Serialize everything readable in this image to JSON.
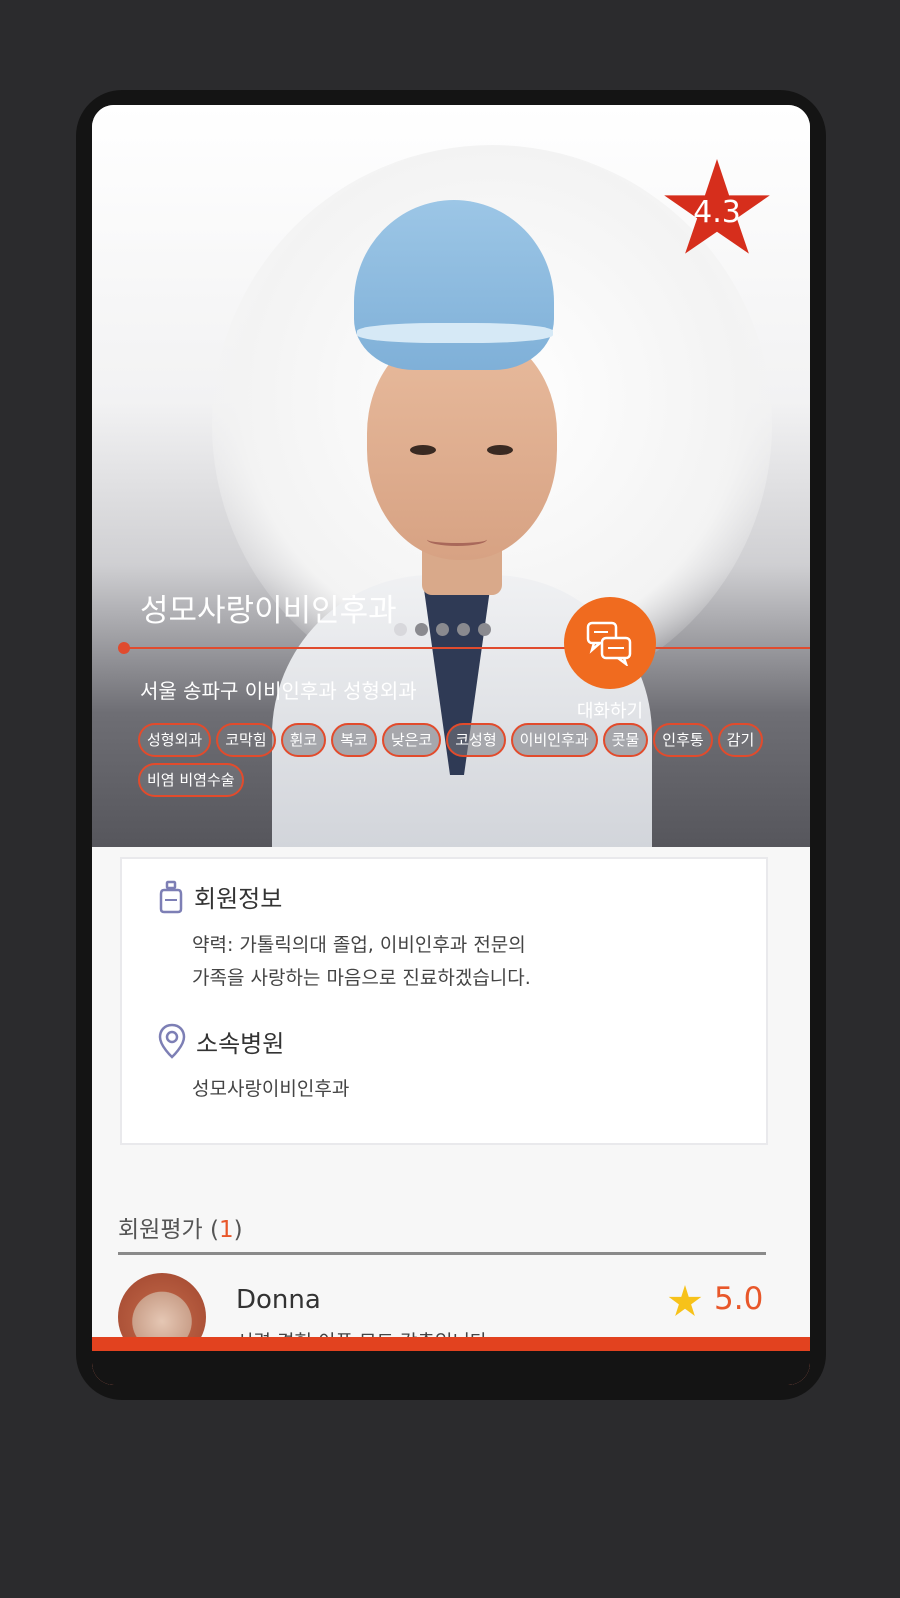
{
  "hero": {
    "rating": "4.3",
    "hospital_name": "성모사랑이비인후과",
    "address": "서울 송파구 이비인후과 성형외과",
    "chat_label": "대화하기",
    "carousel_pages": 5,
    "carousel_active": 1,
    "tags": [
      "성형외과",
      "코막힘",
      "휜코",
      "복코",
      "낮은코",
      "코성형",
      "이비인후과",
      "콧물",
      "인후통",
      "감기",
      "비염 비염수술"
    ]
  },
  "member_info": {
    "title": "회원정보",
    "career_line1": "약력: 가톨릭의대 졸업, 이비인후과 전문의",
    "career_line2": "가족을 사랑하는 마음으로 진료하겠습니다."
  },
  "affiliation": {
    "title": "소속병원",
    "hospital": "성모사랑이비인후과"
  },
  "reviews": {
    "title": "회원평가",
    "count_open": "(",
    "count": "1",
    "count_close": ")",
    "items": [
      {
        "name": "Donna",
        "score": "5.0",
        "snippet": "시력 경험 이픈 모드 각촉입니다"
      }
    ]
  },
  "colors": {
    "accent": "#e8572a",
    "chat_button": "#f06b1f",
    "rating_star": "#d62e1c",
    "review_star": "#f7c21a"
  }
}
